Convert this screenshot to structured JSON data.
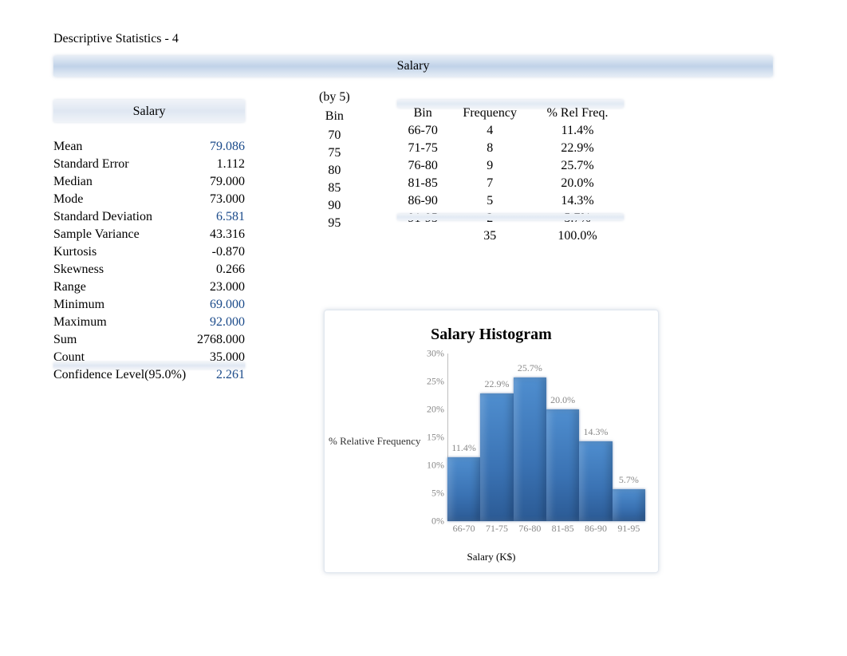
{
  "page_title": "Descriptive Statistics - 4",
  "section_header": "Salary",
  "stats": {
    "header": "Salary",
    "rows": [
      {
        "label": "Mean",
        "value": "79.086",
        "link": true
      },
      {
        "label": "Standard Error",
        "value": "1.112",
        "link": false
      },
      {
        "label": "Median",
        "value": "79.000",
        "link": false
      },
      {
        "label": "Mode",
        "value": "73.000",
        "link": false
      },
      {
        "label": "Standard Deviation",
        "value": "6.581",
        "link": true
      },
      {
        "label": "Sample Variance",
        "value": "43.316",
        "link": false
      },
      {
        "label": "Kurtosis",
        "value": "-0.870",
        "link": false
      },
      {
        "label": "Skewness",
        "value": "0.266",
        "link": false
      },
      {
        "label": "Range",
        "value": "23.000",
        "link": false
      },
      {
        "label": "Minimum",
        "value": "69.000",
        "link": true
      },
      {
        "label": "Maximum",
        "value": "92.000",
        "link": true
      },
      {
        "label": "Sum",
        "value": "2768.000",
        "link": false
      },
      {
        "label": "Count",
        "value": "35.000",
        "link": false
      },
      {
        "label": "Confidence Level(95.0%)",
        "value": "2.261",
        "link": true
      }
    ]
  },
  "bin_list": {
    "note": "(by 5)",
    "header": "Bin",
    "values": [
      "70",
      "75",
      "80",
      "85",
      "90",
      "95"
    ]
  },
  "freq_table": {
    "headers": [
      "Bin",
      "Frequency",
      "% Rel Freq."
    ],
    "rows": [
      {
        "bin": "66-70",
        "freq": "4",
        "rel": "11.4%"
      },
      {
        "bin": "71-75",
        "freq": "8",
        "rel": "22.9%"
      },
      {
        "bin": "76-80",
        "freq": "9",
        "rel": "25.7%"
      },
      {
        "bin": "81-85",
        "freq": "7",
        "rel": "20.0%"
      },
      {
        "bin": "86-90",
        "freq": "5",
        "rel": "14.3%"
      },
      {
        "bin": "91-95",
        "freq": "2",
        "rel": "5.7%"
      }
    ],
    "total_freq": "35",
    "total_rel": "100.0%"
  },
  "chart_data": {
    "type": "bar",
    "title": "Salary Histogram",
    "xlabel": "Salary (K$)",
    "ylabel": "% Relative Frequency",
    "categories": [
      "66-70",
      "71-75",
      "76-80",
      "81-85",
      "86-90",
      "91-95"
    ],
    "values": [
      11.4,
      22.9,
      25.7,
      20.0,
      14.3,
      5.7
    ],
    "value_labels": [
      "11.4%",
      "22.9%",
      "25.7%",
      "20.0%",
      "14.3%",
      "5.7%"
    ],
    "ylim": [
      0,
      30
    ],
    "y_ticks": [
      "0%",
      "5%",
      "10%",
      "15%",
      "20%",
      "25%",
      "30%"
    ]
  }
}
